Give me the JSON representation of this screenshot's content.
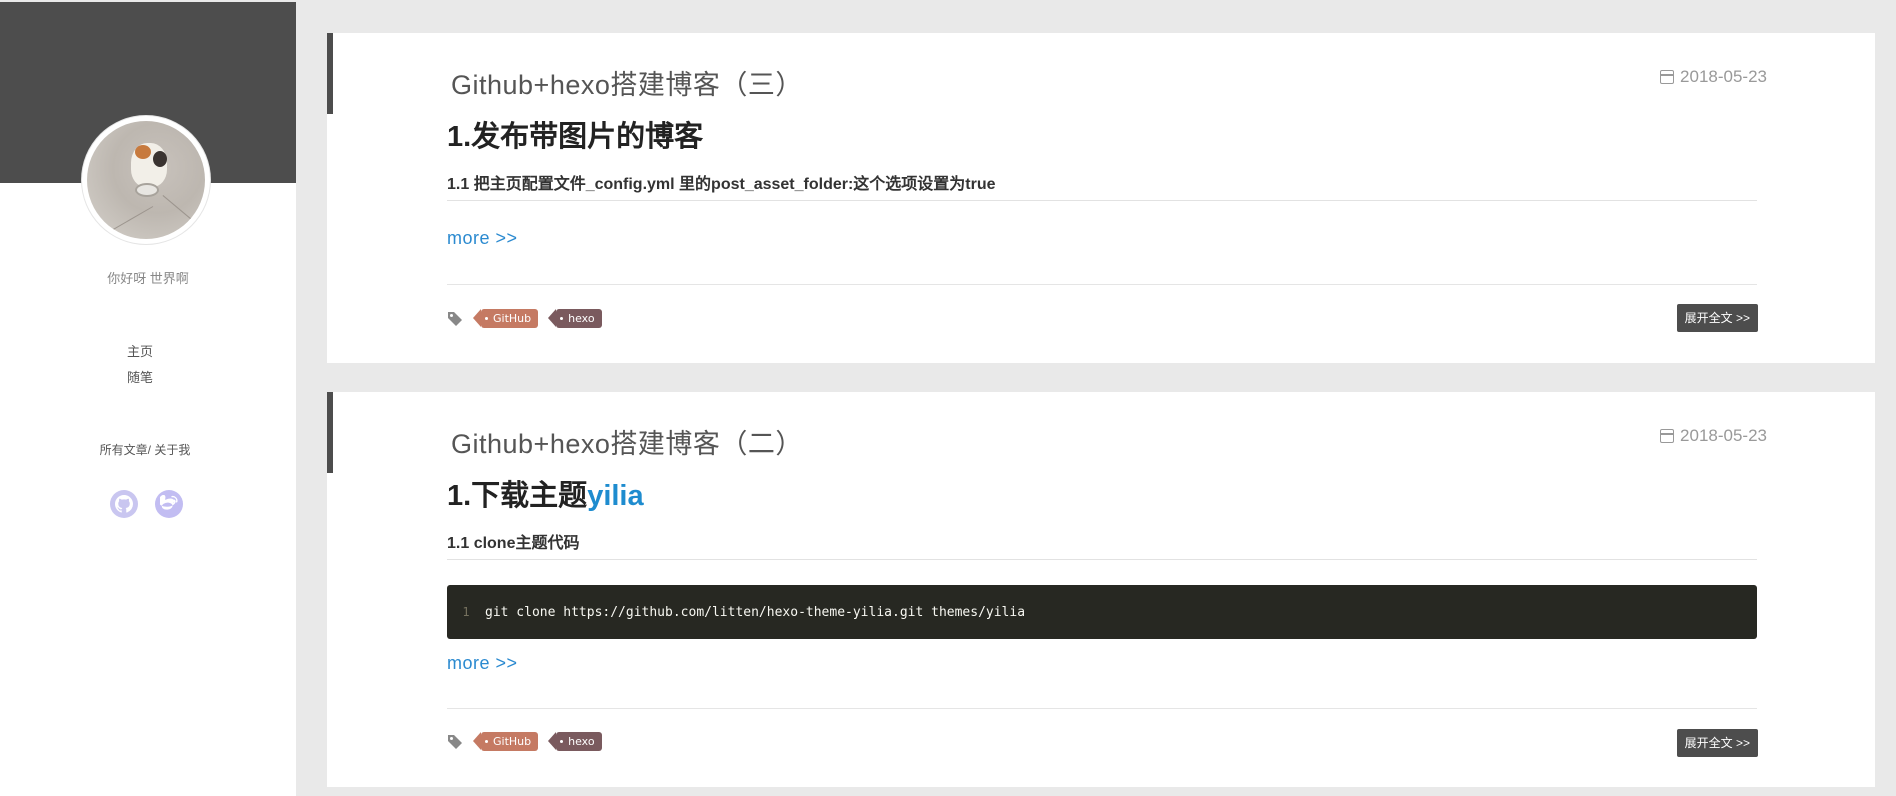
{
  "sidebar": {
    "motto": "你好呀 世界啊",
    "nav": [
      {
        "label": "主页"
      },
      {
        "label": "随笔"
      }
    ],
    "sublinks": {
      "all_posts": "所有文章/",
      "about": "关于我"
    },
    "social": [
      {
        "name": "github-icon"
      },
      {
        "name": "weibo-icon"
      }
    ]
  },
  "posts": [
    {
      "title": "Github+hexo搭建博客（三）",
      "date": "2018-05-23",
      "heading": "1.发布带图片的博客",
      "heading_link": "",
      "subheading": "1.1 把主页配置文件_config.yml 里的post_asset_folder:这个选项设置为true",
      "more": "more >>",
      "tags": [
        "GitHub",
        "hexo"
      ],
      "expand": "展开全文 >>"
    },
    {
      "title": "Github+hexo搭建博客（二）",
      "date": "2018-05-23",
      "heading": "1.下载主题",
      "heading_link": "yilia",
      "subheading": "1.1 clone主题代码",
      "code": {
        "line": "1",
        "text": "git clone https://github.com/litten/hexo-theme-yilia.git themes/yilia"
      },
      "more": "more >>",
      "tags": [
        "GitHub",
        "hexo"
      ],
      "expand": "展开全文 >>"
    }
  ],
  "colors": {
    "sidebar_header": "#4d4d4d",
    "link": "#2b8ad0",
    "tag_github": "#c57a63",
    "tag_hexo": "#7a5a5e",
    "code_bg": "#272822"
  }
}
